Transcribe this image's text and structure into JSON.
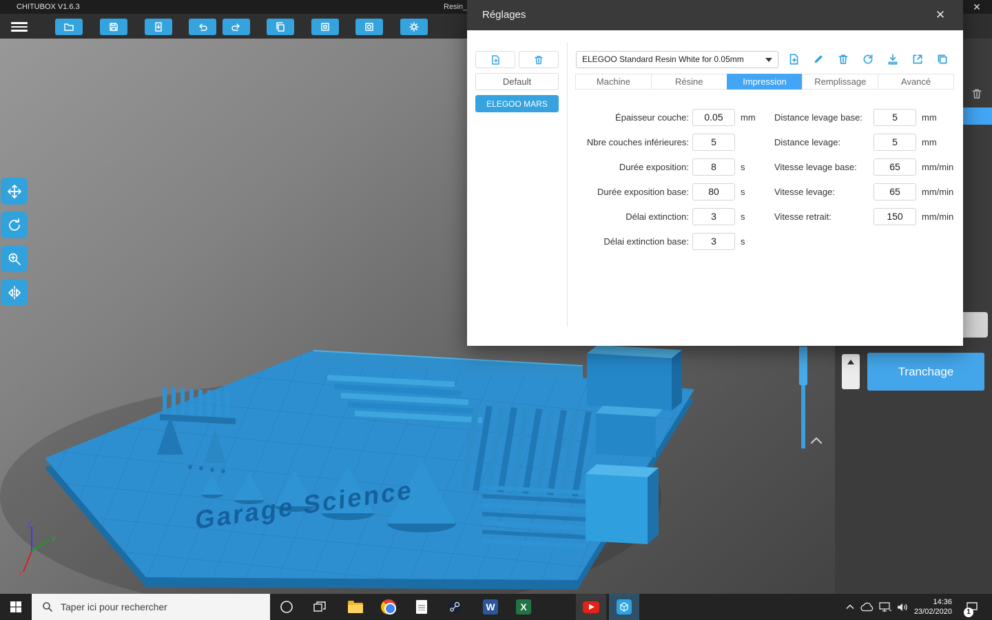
{
  "titlebar": {
    "app_title": "CHITUBOX V1.6.3",
    "document_title": "Resin_",
    "close_icon": "✕"
  },
  "toolbar": {
    "icons": [
      "open-file",
      "save",
      "import-model",
      "undo",
      "redo",
      "copy",
      "hollow",
      "dig-hole",
      "settings"
    ]
  },
  "left_tools": {
    "icons": [
      "move",
      "rotate",
      "scale",
      "mirror"
    ]
  },
  "dialog": {
    "title": "Réglages",
    "close_icon": "✕",
    "machine_list": {
      "default_label": "Default",
      "selected_machine": "ELEGOO MARS"
    },
    "profile_select": {
      "value": "ELEGOO Standard Resin White for 0.05mm"
    },
    "profile_icons": [
      "add-profile",
      "rename-profile",
      "delete-profile",
      "reset-profile",
      "import-profile",
      "export-profile",
      "duplicate-profile"
    ],
    "tabs": [
      "Machine",
      "Résine",
      "Impression",
      "Remplissage",
      "Avancé"
    ],
    "active_tab": "Impression",
    "fields_left": [
      {
        "label": "Épaisseur couche:",
        "value": "0.05",
        "unit": "mm"
      },
      {
        "label": "Nbre couches inférieures:",
        "value": "5",
        "unit": ""
      },
      {
        "label": "Durée exposition:",
        "value": "8",
        "unit": "s"
      },
      {
        "label": "Durée exposition base:",
        "value": "80",
        "unit": "s"
      },
      {
        "label": "Délai extinction:",
        "value": "3",
        "unit": "s"
      },
      {
        "label": "Délai extinction base:",
        "value": "3",
        "unit": "s"
      }
    ],
    "fields_right": [
      {
        "label": "Distance levage base:",
        "value": "5",
        "unit": "mm"
      },
      {
        "label": "Distance levage:",
        "value": "5",
        "unit": "mm"
      },
      {
        "label": "Vitesse levage base:",
        "value": "65",
        "unit": "mm/min"
      },
      {
        "label": "Vitesse levage:",
        "value": "65",
        "unit": "mm/min"
      },
      {
        "label": "Vitesse retrait:",
        "value": "150",
        "unit": "mm/min"
      }
    ]
  },
  "right_panel": {
    "slice_button_label": "Tranchage"
  },
  "viewport": {
    "plate_text": "Garage Science",
    "axis_labels": {
      "x": "X",
      "y": "Y",
      "z": "Z"
    }
  },
  "taskbar": {
    "search_placeholder": "Taper ici pour rechercher",
    "clock_time": "14:36",
    "clock_date": "23/02/2020",
    "notification_badge": "1",
    "icon_letters": {
      "word": "W",
      "excel": "X"
    }
  },
  "colors": {
    "accent_blue": "#35a3dd",
    "active_tab_blue": "#42a5f5",
    "model_blue": "#2e8fd0"
  }
}
